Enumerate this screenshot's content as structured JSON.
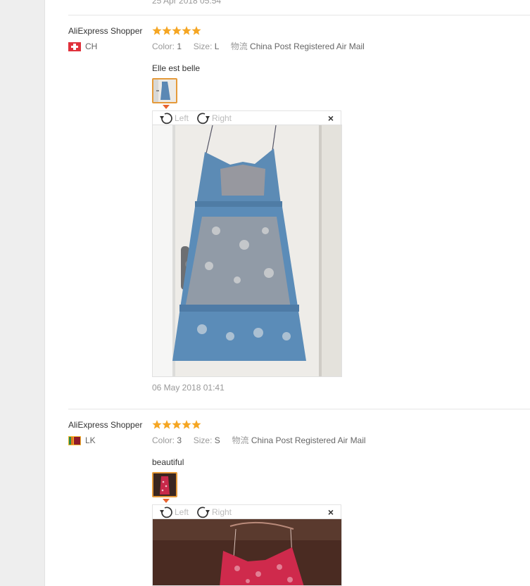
{
  "top_partial_date": "25 Apr 2018 05:54",
  "reviews": [
    {
      "user": "AliExpress Shopper",
      "stars": 5,
      "country": "CH",
      "color_label": "Color:",
      "color_value": "1",
      "size_label": "Size:",
      "size_value": "L",
      "shipping_label": "物流",
      "shipping_value": "China Post Registered Air Mail",
      "feedback": "Elle est belle",
      "rotate_left": "Left",
      "rotate_right": "Right",
      "close": "×",
      "date": "06 May 2018 01:41"
    },
    {
      "user": "AliExpress Shopper",
      "stars": 5,
      "country": "LK",
      "color_label": "Color:",
      "color_value": "3",
      "size_label": "Size:",
      "size_value": "S",
      "shipping_label": "物流",
      "shipping_value": "China Post Registered Air Mail",
      "feedback": "beautiful",
      "rotate_left": "Left",
      "rotate_right": "Right",
      "close": "×"
    }
  ],
  "colors": {
    "star": "#f5a623",
    "accent_border": "#e59a3a",
    "divider": "#e5e5e5"
  }
}
